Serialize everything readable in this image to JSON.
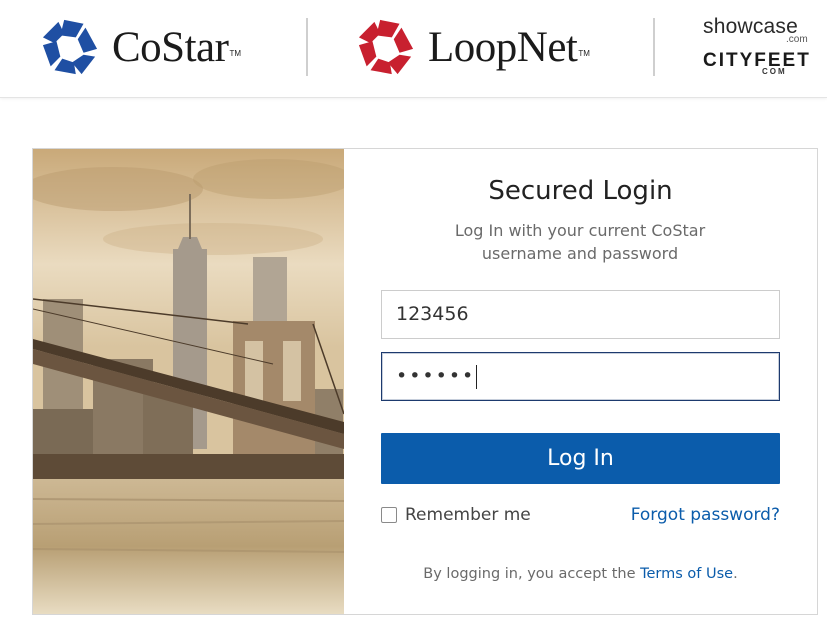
{
  "header": {
    "costar": {
      "name": "CoStar",
      "tm": "TM"
    },
    "loopnet": {
      "name": "LoopNet",
      "tm": "TM"
    },
    "showcase": {
      "name": "showcase",
      "suffix": ".com"
    },
    "cityfeet": {
      "name": "CITYFEET",
      "suffix": "COM"
    }
  },
  "colors": {
    "costar_blue": "#1f4fa3",
    "loopnet_red": "#c8202f",
    "button_blue": "#0b5cab",
    "link_blue": "#0b5cab"
  },
  "login": {
    "title": "Secured Login",
    "subtitle": "Log In with your current CoStar username and password",
    "username_value": "123456",
    "password_masked": "••••••",
    "login_button": "Log In",
    "remember_label": "Remember me",
    "remember_checked": false,
    "forgot_link": "Forgot password?",
    "terms_prefix": "By logging in, you accept the",
    "terms_link": "Terms of Use",
    "terms_suffix": "."
  },
  "icons": {
    "costar_logo": "costar-star-icon",
    "loopnet_logo": "loopnet-star-icon",
    "checkbox": "checkbox-icon"
  }
}
